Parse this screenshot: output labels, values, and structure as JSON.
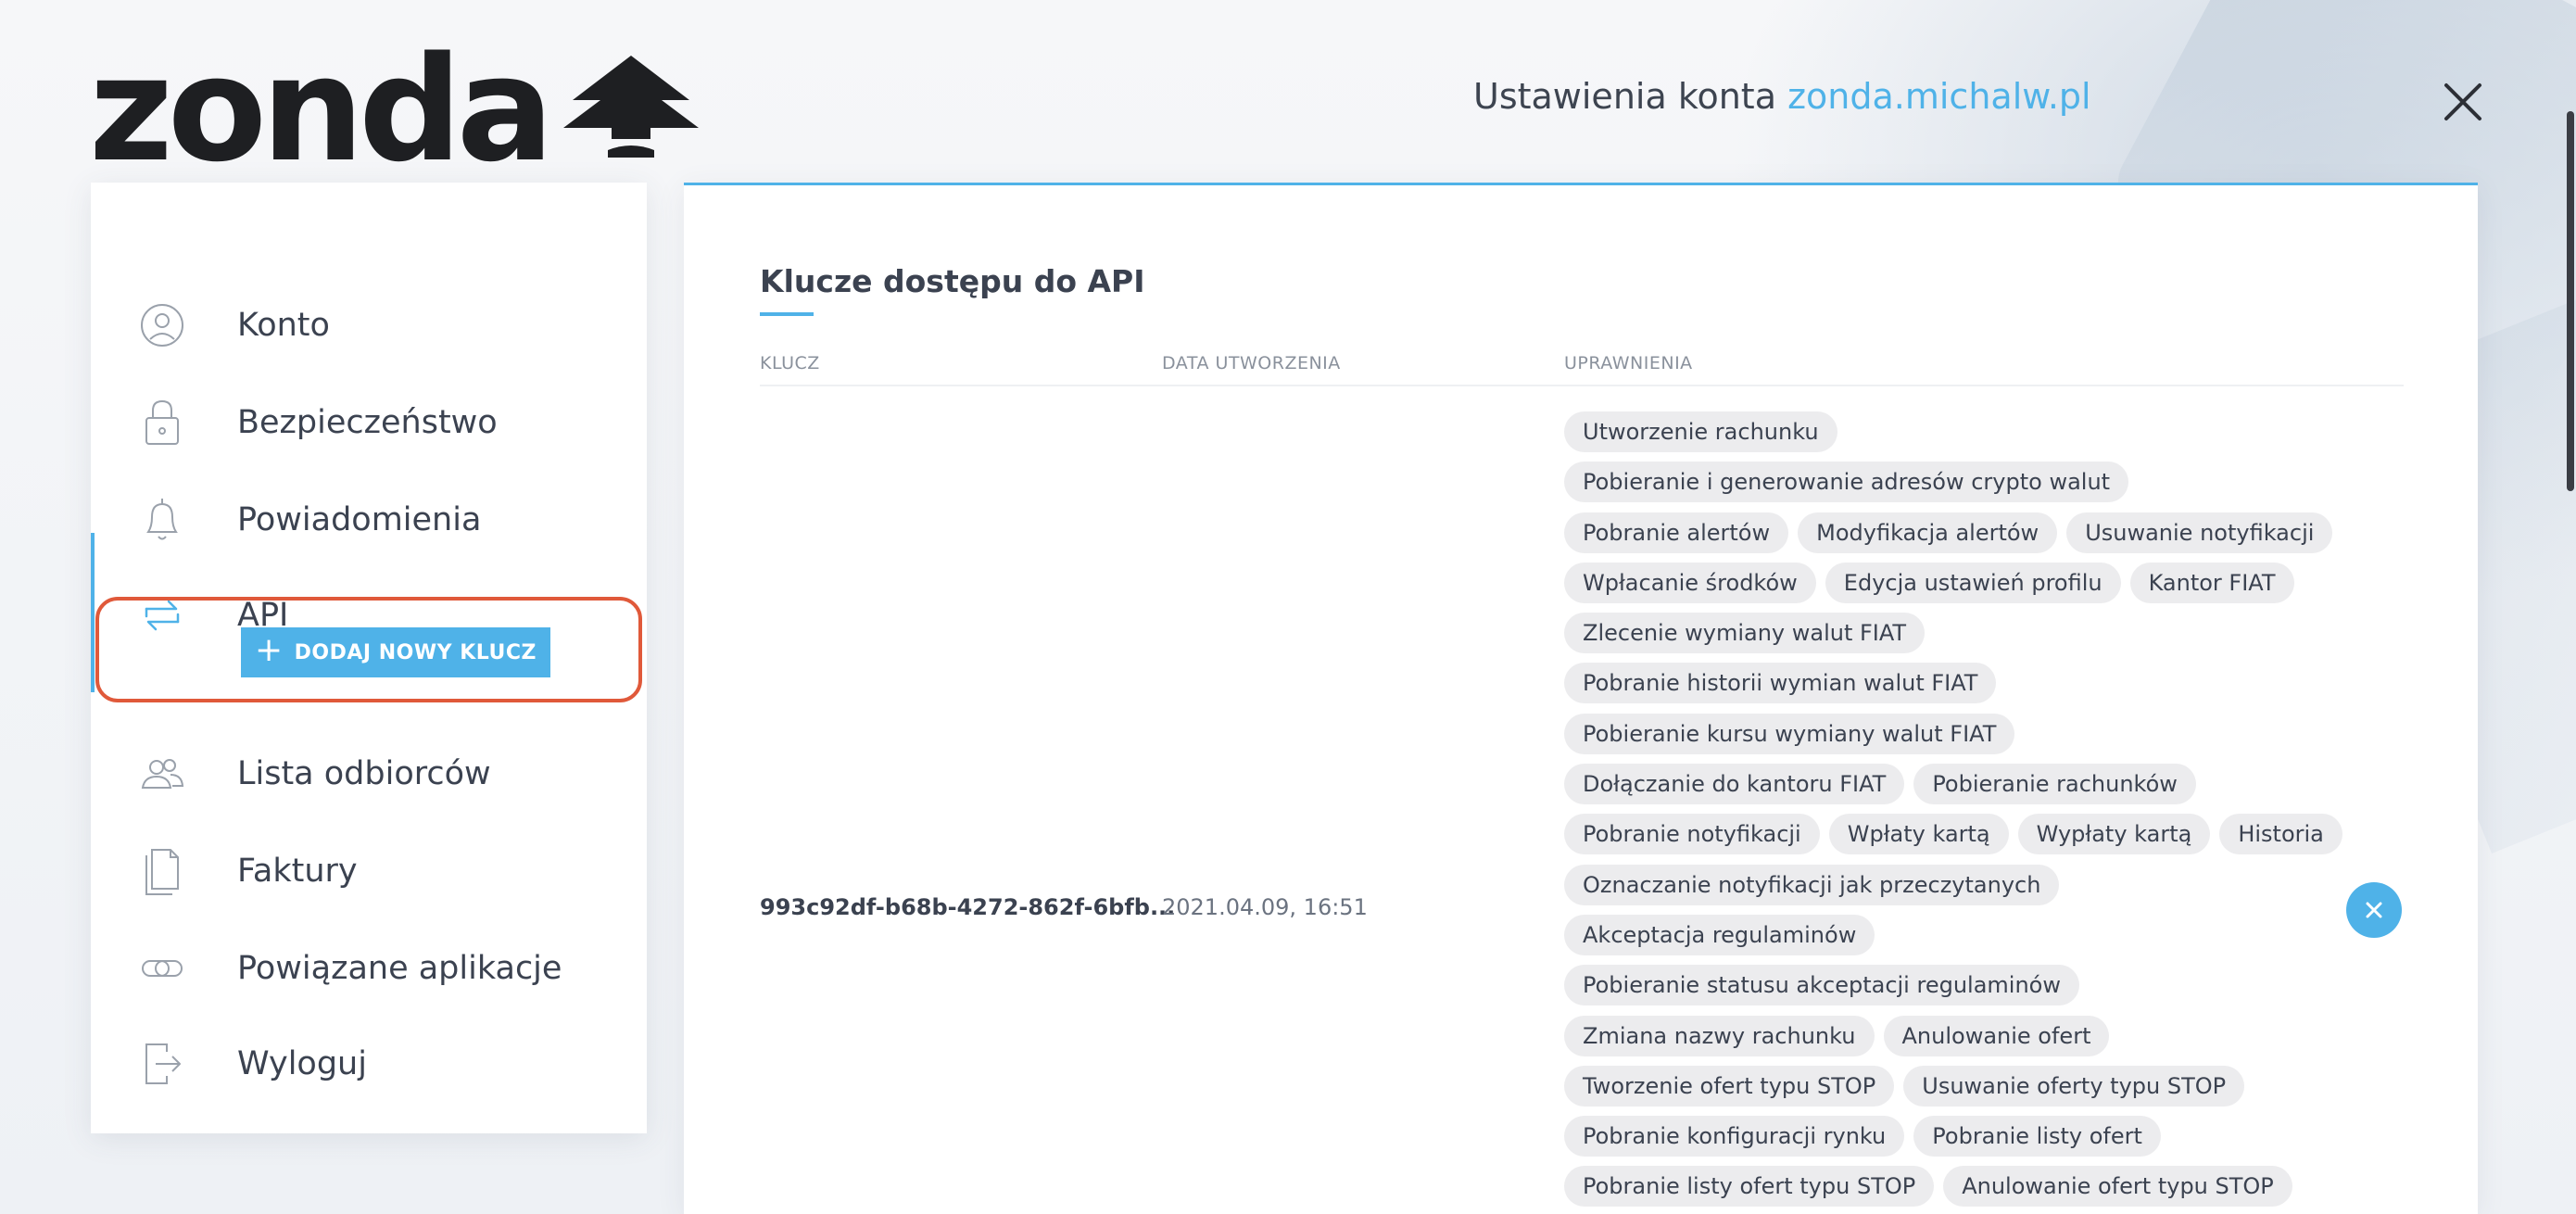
{
  "logo": {
    "text": "zonda"
  },
  "header": {
    "title_prefix": "Ustawienia konta",
    "domain": "zonda.michalw.pl"
  },
  "sidebar": {
    "items": [
      {
        "label": "Konto",
        "icon": "user-circle-icon"
      },
      {
        "label": "Bezpieczeństwo",
        "icon": "lock-icon"
      },
      {
        "label": "Powiadomienia",
        "icon": "bell-icon"
      },
      {
        "label": "API",
        "icon": "api-arrows-icon",
        "active": true
      },
      {
        "label": "Lista odbiorców",
        "icon": "users-icon"
      },
      {
        "label": "Faktury",
        "icon": "documents-icon"
      },
      {
        "label": "Powiązane aplikacje",
        "icon": "link-icon"
      },
      {
        "label": "Wyloguj",
        "icon": "logout-icon"
      }
    ],
    "add_key_label": "DODAJ NOWY KLUCZ"
  },
  "main": {
    "section_title": "Klucze dostępu do API",
    "columns": [
      "KLUCZ",
      "DATA UTWORZENIA",
      "UPRAWNIENIA"
    ],
    "row": {
      "key": "993c92df-b68b-4272-862f-6bfb...",
      "created": "2021.04.09, 16:51",
      "permission_rows": [
        [
          "Utworzenie rachunku"
        ],
        [
          "Pobieranie i generowanie adresów crypto walut"
        ],
        [
          "Pobranie alertów",
          "Modyfikacja alertów",
          "Usuwanie notyfikacji"
        ],
        [
          "Wpłacanie środków",
          "Edycja ustawień profilu",
          "Kantor FIAT"
        ],
        [
          "Zlecenie wymiany walut FIAT"
        ],
        [
          "Pobranie historii wymian walut FIAT"
        ],
        [
          "Pobieranie kursu wymiany walut FIAT"
        ],
        [
          "Dołączanie do kantoru FIAT",
          "Pobieranie rachunków"
        ],
        [
          "Pobranie notyfikacji",
          "Wpłaty kartą",
          "Wypłaty kartą",
          "Historia"
        ],
        [
          "Oznaczanie notyfikacji jak przeczytanych"
        ],
        [
          "Akceptacja regulaminów"
        ],
        [
          "Pobieranie statusu akceptacji regulaminów"
        ],
        [
          "Zmiana nazwy rachunku",
          "Anulowanie ofert"
        ],
        [
          "Tworzenie ofert typu STOP",
          "Usuwanie oferty typu STOP"
        ],
        [
          "Pobranie konfiguracji rynku",
          "Pobranie listy ofert"
        ],
        [
          "Pobranie listy ofert typu STOP",
          "Anulowanie ofert typu STOP"
        ]
      ]
    }
  },
  "colors": {
    "accent": "#4fb2e8",
    "highlight": "#e0593a",
    "tag_bg": "#ececee"
  }
}
